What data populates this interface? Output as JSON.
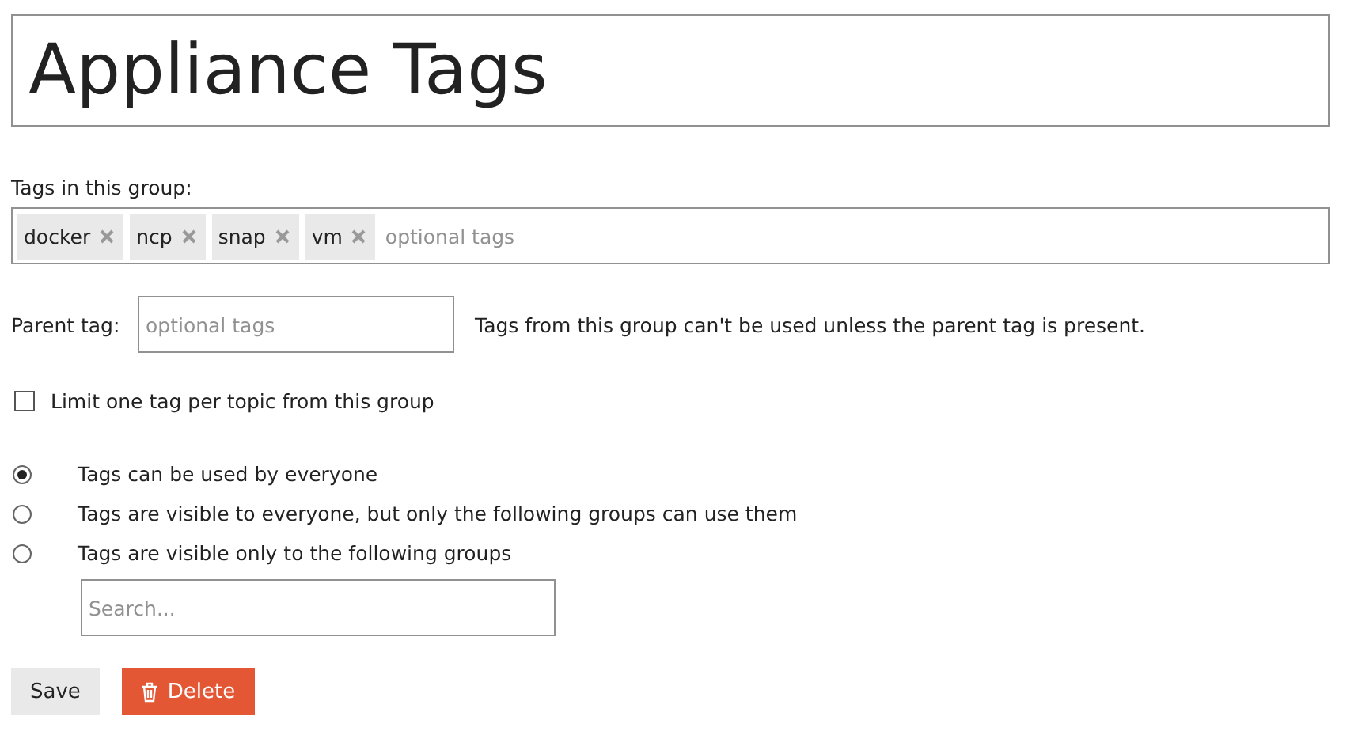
{
  "title": "Appliance Tags",
  "tags_label": "Tags in this group:",
  "tags": [
    "docker",
    "ncp",
    "snap",
    "vm"
  ],
  "tags_placeholder": "optional tags",
  "parent_tag": {
    "label": "Parent tag:",
    "placeholder": "optional tags",
    "hint": "Tags from this group can't be used unless the parent tag is present."
  },
  "limit_one": {
    "label": "Limit one tag per topic from this group",
    "checked": false
  },
  "permissions": [
    {
      "label": "Tags can be used by everyone",
      "selected": true
    },
    {
      "label": "Tags are visible to everyone, but only the following groups can use them",
      "selected": false
    },
    {
      "label": "Tags are visible only to the following groups",
      "selected": false
    }
  ],
  "groups_search": {
    "placeholder": "Search..."
  },
  "buttons": [
    {
      "kind": "save",
      "label": "Save"
    },
    {
      "kind": "delete",
      "label": "Delete"
    }
  ]
}
